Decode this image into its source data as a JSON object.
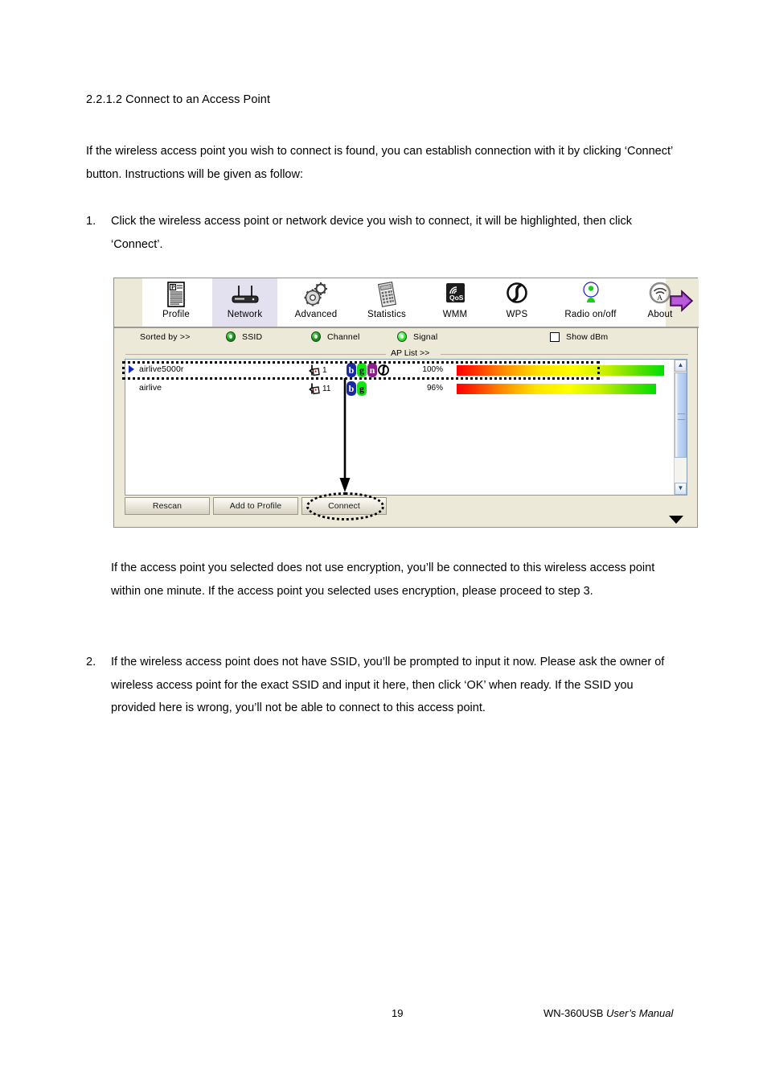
{
  "document": {
    "heading": "2.2.1.2 Connect to an Access Point",
    "intro": "If the wireless access point you wish to connect is found, you can establish connection with it by clicking ‘Connect’ button. Instructions will be given as follow:",
    "steps": [
      {
        "number": "1.",
        "text": "Click the wireless access point or network device you wish to connect, it will be highlighted, then click ‘Connect’."
      },
      {
        "number": "2.",
        "text": "If the wireless access point does not have SSID, you’ll be prompted to input it now. Please ask the owner of wireless access point for the exact SSID and input it here, then click ‘OK’ when ready. If the SSID you provided here is wrong, you’ll not be able to connect to this access point."
      }
    ],
    "note": "If the access point you selected does not use encryption, you’ll be connected to this wireless access point within one minute. If the access point you selected uses encryption, please proceed to step 3.",
    "footer": {
      "page_number": "19",
      "product": "WN-360USB",
      "manual_label": "User’s  Manual"
    }
  },
  "utility": {
    "toolbar": {
      "tabs": [
        {
          "label": "Profile",
          "icon": "profile-icon",
          "active": false
        },
        {
          "label": "Network",
          "icon": "router-icon",
          "active": true
        },
        {
          "label": "Advanced",
          "icon": "gears-icon",
          "active": false
        },
        {
          "label": "Statistics",
          "icon": "calculator-icon",
          "active": false
        },
        {
          "label": "WMM",
          "icon": "qos-icon",
          "active": false
        },
        {
          "label": "WPS",
          "icon": "wps-icon",
          "active": false
        },
        {
          "label": "Radio on/off",
          "icon": "antenna-icon",
          "active": false
        },
        {
          "label": "About",
          "icon": "about-wifi-icon",
          "active": false
        }
      ],
      "next_icon": "right-arrow-icon"
    },
    "sort_bar": {
      "label": "Sorted by >>",
      "options": [
        {
          "label": "SSID",
          "selected": false
        },
        {
          "label": "Channel",
          "selected": false
        },
        {
          "label": "Signal",
          "selected": true
        }
      ],
      "show_dbm": {
        "label": "Show dBm",
        "checked": false
      }
    },
    "ap_list_divider": "AP List >>",
    "ap_rows": [
      {
        "ssid": "airlive5000r",
        "channel": "1",
        "badges": [
          "b",
          "g",
          "n"
        ],
        "has_wps": true,
        "signal_pct": "100%",
        "signal_value": 100,
        "selected": true
      },
      {
        "ssid": "airlive",
        "channel": "11",
        "badges": [
          "b",
          "g"
        ],
        "has_wps": false,
        "signal_pct": "96%",
        "signal_value": 96,
        "selected": false
      }
    ],
    "buttons": [
      {
        "label": "Rescan"
      },
      {
        "label": "Add to Profile"
      },
      {
        "label": "Connect"
      }
    ],
    "scrollbar": {
      "up_icon": "chevron-up-icon",
      "down_icon": "chevron-down-icon"
    },
    "collapse_icon": "triangle-down-icon",
    "colors": {
      "window_bg": "#ece9d8",
      "active_tab": "#e3e1f0",
      "badge_b": "#1a2a9e",
      "badge_g": "#12e312",
      "badge_n": "#8a1f8a",
      "marker": "#1226b4"
    }
  }
}
